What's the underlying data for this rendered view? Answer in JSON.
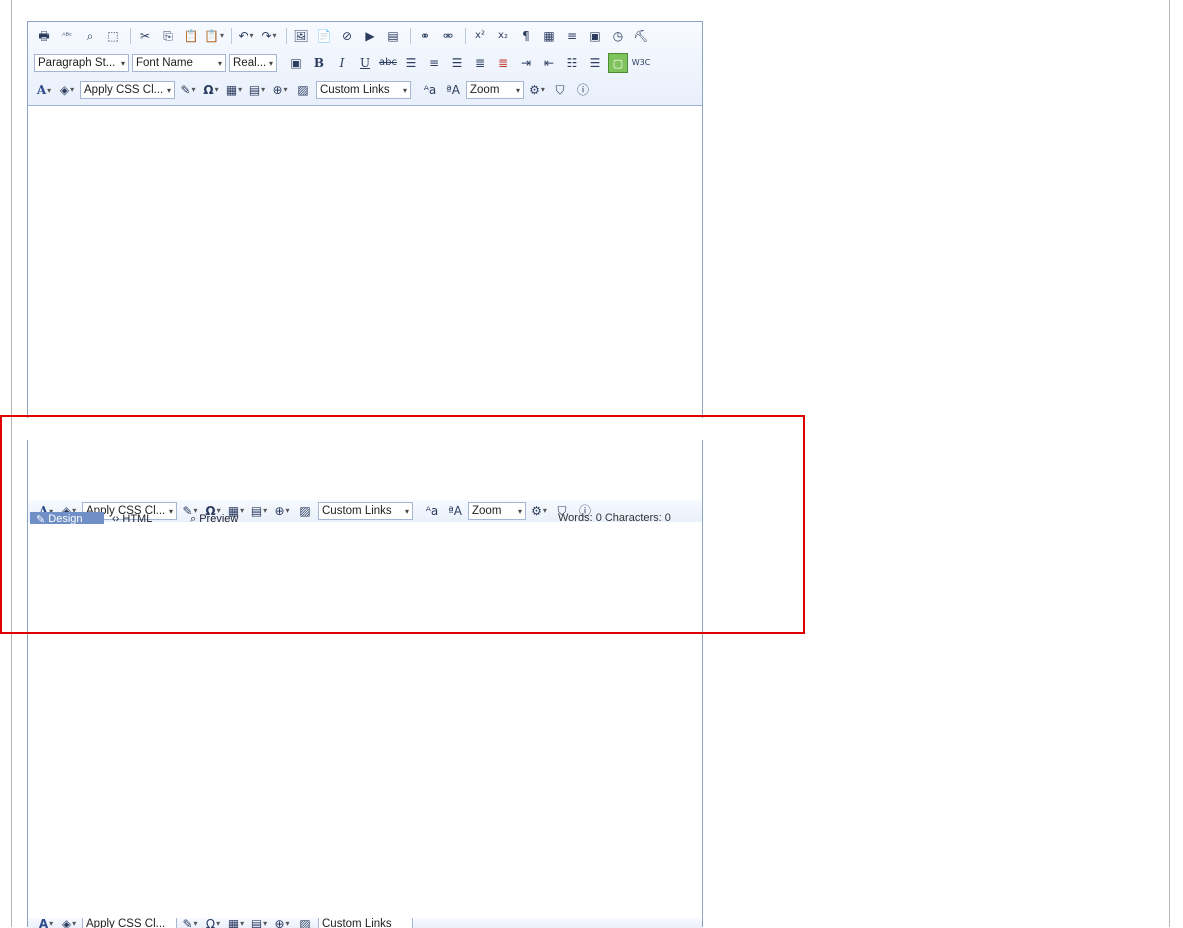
{
  "toolbar": {
    "paragraph_style": "Paragraph St...",
    "font_name": "Font Name",
    "font_size": "Real...",
    "apply_css_class": "Apply CSS Cl...",
    "custom_links": "Custom Links",
    "zoom": "Zoom",
    "buttons_row1": [
      {
        "name": "print",
        "glyph": "🖶"
      },
      {
        "name": "spellcheck",
        "glyph": "ᴬᴮᶜ"
      },
      {
        "name": "find-replace",
        "glyph": "⌕"
      },
      {
        "name": "select-all",
        "glyph": "⬚"
      },
      {
        "name": "cut",
        "glyph": "✂"
      },
      {
        "name": "copy",
        "glyph": "⎘"
      },
      {
        "name": "paste",
        "glyph": "📋"
      },
      {
        "name": "paste-options",
        "glyph": "📋"
      },
      {
        "name": "undo",
        "glyph": "↶"
      },
      {
        "name": "redo",
        "glyph": "↷"
      },
      {
        "name": "image-manager",
        "glyph": "🖼"
      },
      {
        "name": "document-manager",
        "glyph": "📄"
      },
      {
        "name": "flash-manager",
        "glyph": "⊘"
      },
      {
        "name": "media-manager",
        "glyph": "▶"
      },
      {
        "name": "template-manager",
        "glyph": "▤"
      },
      {
        "name": "link-manager",
        "glyph": "⚭"
      },
      {
        "name": "remove-link",
        "glyph": "⚮"
      },
      {
        "name": "superscript",
        "glyph": "x²"
      },
      {
        "name": "subscript",
        "glyph": "x₂"
      },
      {
        "name": "paragraph-insert",
        "glyph": "¶"
      },
      {
        "name": "clipboard",
        "glyph": "▦"
      },
      {
        "name": "align",
        "glyph": "≡"
      },
      {
        "name": "form",
        "glyph": "▣"
      },
      {
        "name": "time",
        "glyph": "◷"
      },
      {
        "name": "format-stripper",
        "glyph": "⛏"
      }
    ]
  },
  "tabs": {
    "design": "Design",
    "html": "HTML",
    "preview": "Preview"
  },
  "status": {
    "text": "Words: 0   Characters: 0"
  }
}
